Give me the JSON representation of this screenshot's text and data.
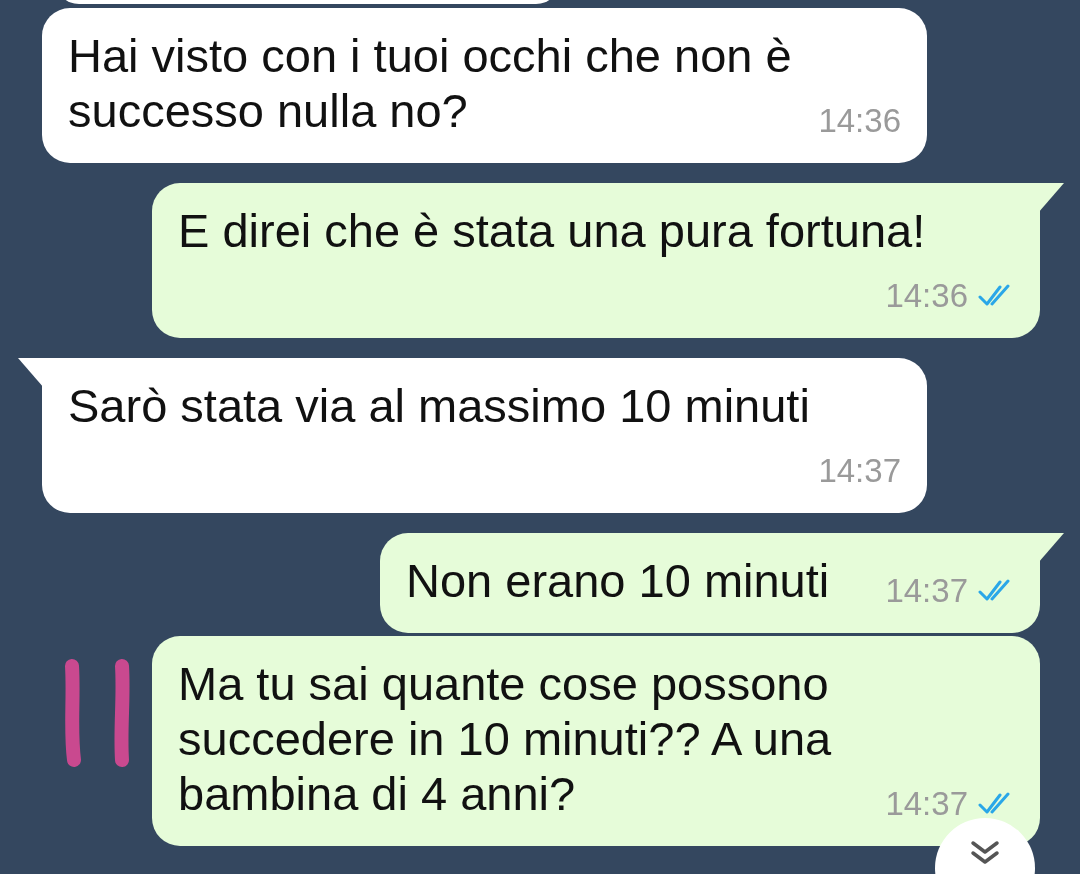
{
  "messages": [
    {
      "kind": "incoming",
      "tail": false,
      "text": "Hai visto con i tuoi occhi che non è successo nulla no?",
      "time": "14:36"
    },
    {
      "kind": "outgoing",
      "tail": true,
      "text": "E direi che è stata una pura fortuna!",
      "time": "14:36",
      "read": true
    },
    {
      "kind": "incoming",
      "tail": true,
      "text": "Sarò stata via al massimo 10 minuti",
      "time": "14:37"
    },
    {
      "kind": "outgoing",
      "tail": true,
      "text": "Non erano 10 minuti",
      "time": "14:37",
      "read": true
    },
    {
      "kind": "outgoing",
      "tail": false,
      "text": "Ma tu sai quante cose possono succedere in 10 minuti?? A una bambina di 4 anni?",
      "time": "14:37",
      "read": true,
      "annotated": true
    }
  ]
}
